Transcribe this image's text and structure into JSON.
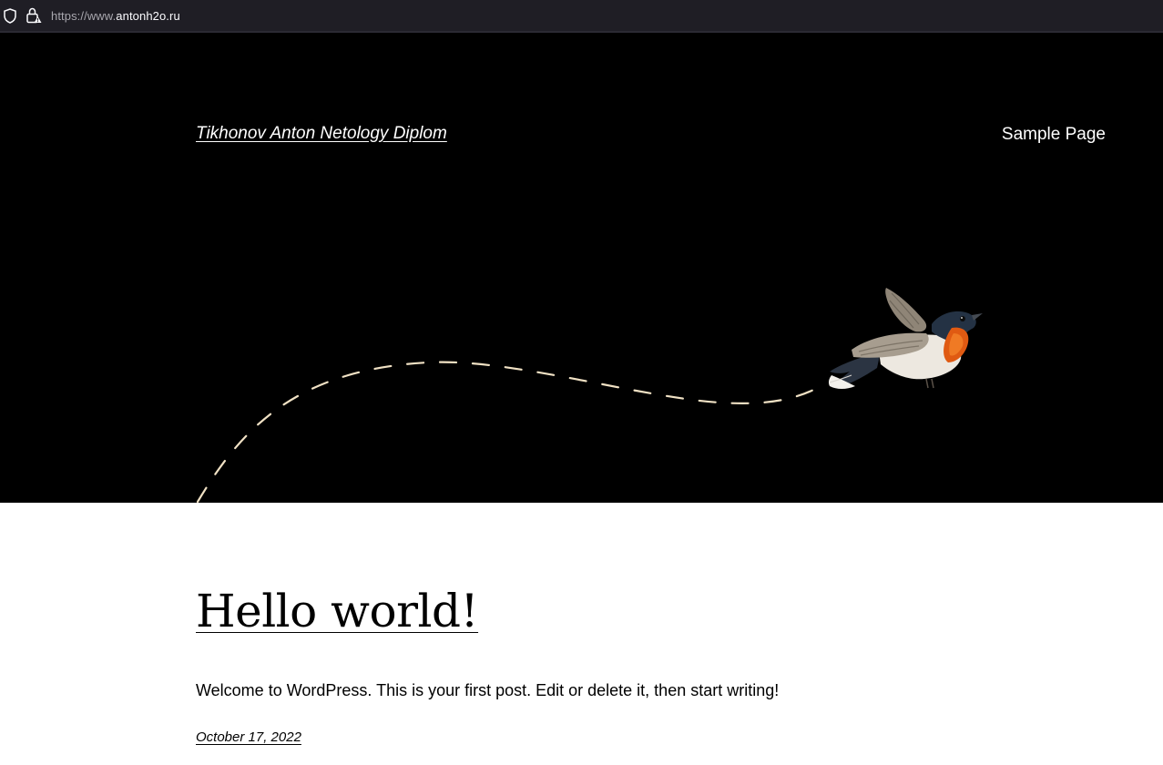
{
  "browser": {
    "url_protocol": "https://www.",
    "url_domain": "antonh2o.ru",
    "shield_icon": "tracking-protection-shield-icon",
    "lock_icon": "insecure-lock-icon"
  },
  "header": {
    "site_title": "Tikhonov Anton Netology Diplom",
    "nav_items": [
      {
        "label": "Sample Page"
      }
    ]
  },
  "hero": {
    "image": "flying-bird-illustration",
    "path": "dashed-flight-path",
    "path_color": "#f0e1c4"
  },
  "post": {
    "title": "Hello world!",
    "excerpt": "Welcome to WordPress. This is your first post. Edit or delete it, then start writing!",
    "date": "October 17, 2022"
  },
  "colors": {
    "hero_background": "#000000",
    "page_background": "#ffffff",
    "text_dark": "#000000",
    "text_light": "#ffffff"
  }
}
